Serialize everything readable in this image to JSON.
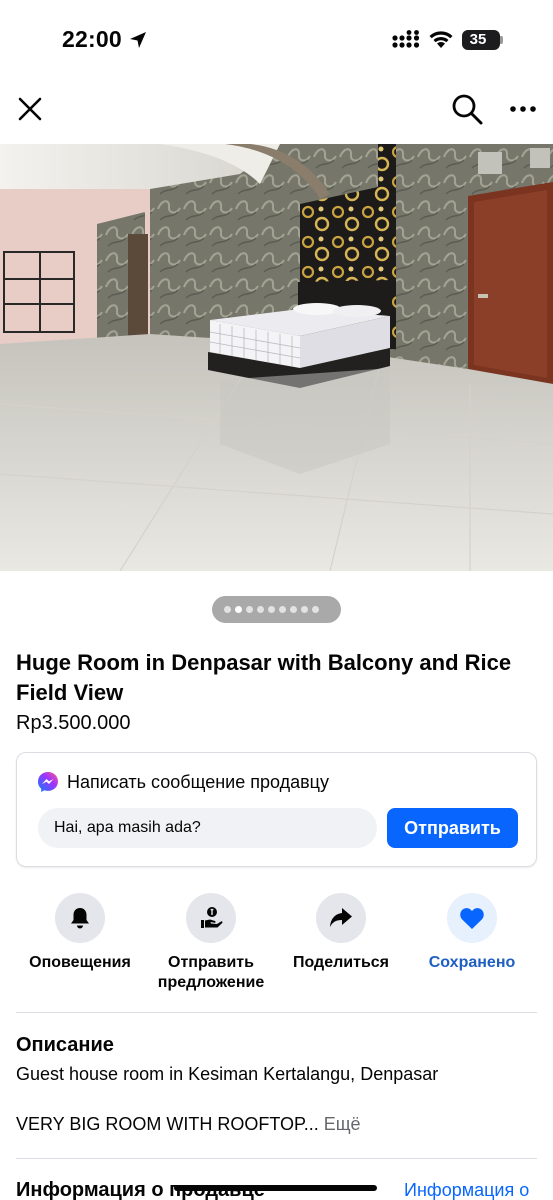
{
  "status_bar": {
    "time": "22:00",
    "battery": "35",
    "icons": [
      "location-arrow-icon",
      "cellular-signal-icon",
      "wifi-icon",
      "battery-icon"
    ]
  },
  "nav": {
    "icons": [
      "close-icon",
      "search-icon",
      "more-icon"
    ]
  },
  "gallery": {
    "photo_count": 9,
    "active_index": 1
  },
  "listing": {
    "title": "Huge Room in Denpasar with Balcony and Rice Field View",
    "price": "Rp3.500.000"
  },
  "message": {
    "heading": "Написать сообщение продавцу",
    "input_value": "Hai, apa masih ada?",
    "send_label": "Отправить",
    "icon": "messenger-icon",
    "accent": "#0866ff"
  },
  "actions": [
    {
      "label": "Оповещения",
      "icon": "bell-icon"
    },
    {
      "label": "Отправить предложение",
      "icon": "offer-icon"
    },
    {
      "label": "Поделиться",
      "icon": "share-icon"
    },
    {
      "label": "Сохранено",
      "icon": "bookmark-icon",
      "active_color": "#1f5fbf"
    }
  ],
  "description": {
    "heading": "Описание",
    "line1": "Guest house room in Kesiman Kertalangu, Denpasar",
    "line2": "VERY BIG ROOM WITH ROOFTOP...",
    "more": "Ещё"
  },
  "seller": {
    "heading": "Информация о продавце",
    "link": "Информация о"
  }
}
